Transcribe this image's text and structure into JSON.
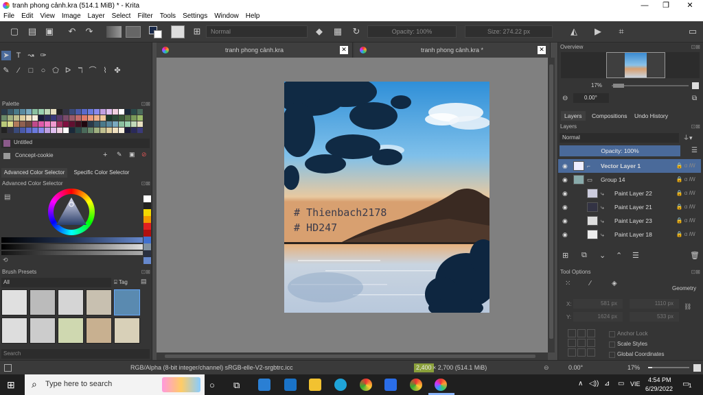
{
  "window": {
    "title": "tranh phong cảnh.kra (514.1 MiB)  * - Krita",
    "minimize": "—",
    "maximize": "❐",
    "close": "✕"
  },
  "menu": [
    "File",
    "Edit",
    "View",
    "Image",
    "Layer",
    "Select",
    "Filter",
    "Tools",
    "Settings",
    "Window",
    "Help"
  ],
  "toolbar": {
    "blend_mode": "Normal",
    "opacity": "Opacity: 100%",
    "size": "Size: 274.22 px"
  },
  "left_panel": {
    "palette_title": "Palette",
    "palette_name": "Untitled",
    "palette_set": "Concept-cookie",
    "color_tabs": [
      "Advanced Color Selector",
      "Specific Color Selector"
    ],
    "advanced_color_title": "Advanced Color Selector",
    "brush_presets_title": "Brush Presets",
    "brush_filter": "All",
    "brush_tag": "Tag",
    "search_placeholder": "Search"
  },
  "tabs": [
    {
      "label": "tranh phong cảnh.kra",
      "close": "✕"
    },
    {
      "label": "tranh phong cảnh.kra *",
      "close": "✕"
    }
  ],
  "artwork": {
    "text_line1": "# Thienbach2178",
    "text_line2": "# HD247"
  },
  "right_panel": {
    "overview_title": "Overview",
    "zoom": "17%",
    "rotation": "0.00°",
    "tabs": [
      "Layers",
      "Compositions",
      "Undo History"
    ],
    "layers_title": "Layers",
    "blend_mode": "Normal",
    "opacity": "Opacity:  100%",
    "layers": [
      {
        "name": "Vector Layer 1",
        "selected": true
      },
      {
        "name": "Group 14",
        "selected": false
      },
      {
        "name": "Paint Layer 22",
        "selected": false
      },
      {
        "name": "Paint Layer 21",
        "selected": false
      },
      {
        "name": "Paint Layer 23",
        "selected": false
      },
      {
        "name": "Paint Layer 18",
        "selected": false
      }
    ],
    "tool_options_title": "Tool Options",
    "geometry_label": "Geometry",
    "x_label": "X:",
    "x_value": "581 px",
    "x_value2": "1110 px",
    "y_label": "Y:",
    "y_value": "1624 px",
    "y_value2": "533 px",
    "anchor_lock": "Anchor Lock",
    "scale_styles": "Scale Styles",
    "global_coords": "Global Coordinates"
  },
  "statusbar": {
    "color_info": "RGB/Alpha (8-bit integer/channel)  sRGB-elle-V2-srgbtrc.icc",
    "size_badge": "2,400",
    "size_info": "× 2,700 (514.1 MiB)",
    "rotation": "0.00°",
    "zoom": "17%"
  },
  "taskbar": {
    "search_placeholder": "Type here to search",
    "language": "VIE",
    "time": "4:54 PM",
    "date": "6/29/2022",
    "notifications": "1"
  }
}
